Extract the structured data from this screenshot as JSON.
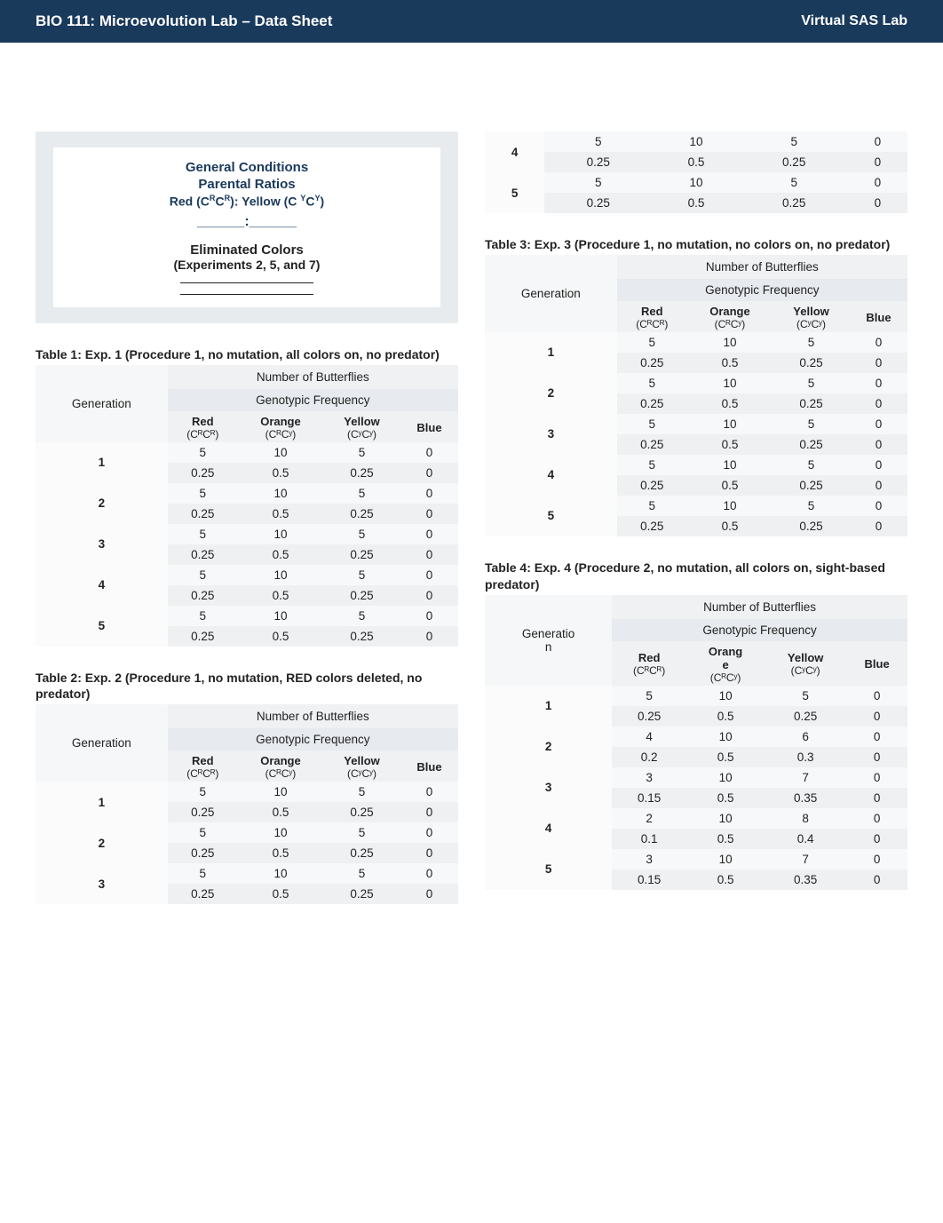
{
  "header": {
    "left": "BIO 111: Microevolution Lab – Data Sheet",
    "right": "Virtual SAS Lab"
  },
  "conditions": {
    "title": "General Conditions",
    "subtitle": "Parental Ratios",
    "formula_prefix": "Red (C",
    "formula_mid": "): Yellow (C ",
    "formula_suffix": ")",
    "sup_r": "R",
    "sup_y": "Y",
    "blank": "______:______",
    "elim_title": "Eliminated Colors",
    "elim_sub": "(Experiments 2, 5, and 7)"
  },
  "colheads": {
    "generation": "Generation",
    "generation_short": "Generatio\nn",
    "num_butterflies": "Number of Butterflies",
    "geno_freq": "Genotypic Frequency",
    "red": "Red",
    "red_sub": "(CᴿCᴿ)",
    "orange": "Orange",
    "orange_split": "Orang\ne",
    "orange_sub": "(CᴿCʸ)",
    "yellow": "Yellow",
    "yellow_sub": "(CʸCʸ)",
    "blue": "Blue"
  },
  "tables": [
    {
      "title": "Table 1: Exp. 1 (Procedure 1, no mutation, all colors on, no predator)",
      "rows": [
        {
          "gen": "1",
          "count": [
            5,
            10,
            5,
            0
          ],
          "freq": [
            0.25,
            0.5,
            0.25,
            0
          ]
        },
        {
          "gen": "2",
          "count": [
            5,
            10,
            5,
            0
          ],
          "freq": [
            0.25,
            0.5,
            0.25,
            0
          ]
        },
        {
          "gen": "3",
          "count": [
            5,
            10,
            5,
            0
          ],
          "freq": [
            0.25,
            0.5,
            0.25,
            0
          ]
        },
        {
          "gen": "4",
          "count": [
            5,
            10,
            5,
            0
          ],
          "freq": [
            0.25,
            0.5,
            0.25,
            0
          ]
        },
        {
          "gen": "5",
          "count": [
            5,
            10,
            5,
            0
          ],
          "freq": [
            0.25,
            0.5,
            0.25,
            0
          ]
        }
      ]
    },
    {
      "title": "Table 2: Exp. 2 (Procedure 1, no mutation, RED colors deleted, no predator)",
      "rows": [
        {
          "gen": "1",
          "count": [
            5,
            10,
            5,
            0
          ],
          "freq": [
            0.25,
            0.5,
            0.25,
            0
          ]
        },
        {
          "gen": "2",
          "count": [
            5,
            10,
            5,
            0
          ],
          "freq": [
            0.25,
            0.5,
            0.25,
            0
          ]
        },
        {
          "gen": "3",
          "count": [
            5,
            10,
            5,
            0
          ],
          "freq": [
            0.25,
            0.5,
            0.25,
            0
          ]
        },
        {
          "gen": "4",
          "count": [
            5,
            10,
            5,
            0
          ],
          "freq": [
            0.25,
            0.5,
            0.25,
            0
          ]
        },
        {
          "gen": "5",
          "count": [
            5,
            10,
            5,
            0
          ],
          "freq": [
            0.25,
            0.5,
            0.25,
            0
          ]
        }
      ]
    },
    {
      "title": "Table 3: Exp. 3 (Procedure 1, no mutation, no colors on, no predator)",
      "rows": [
        {
          "gen": "1",
          "count": [
            5,
            10,
            5,
            0
          ],
          "freq": [
            0.25,
            0.5,
            0.25,
            0
          ]
        },
        {
          "gen": "2",
          "count": [
            5,
            10,
            5,
            0
          ],
          "freq": [
            0.25,
            0.5,
            0.25,
            0
          ]
        },
        {
          "gen": "3",
          "count": [
            5,
            10,
            5,
            0
          ],
          "freq": [
            0.25,
            0.5,
            0.25,
            0
          ]
        },
        {
          "gen": "4",
          "count": [
            5,
            10,
            5,
            0
          ],
          "freq": [
            0.25,
            0.5,
            0.25,
            0
          ]
        },
        {
          "gen": "5",
          "count": [
            5,
            10,
            5,
            0
          ],
          "freq": [
            0.25,
            0.5,
            0.25,
            0
          ]
        }
      ]
    },
    {
      "title": "Table 4: Exp. 4 (Procedure 2, no mutation, all colors on, sight-based predator)",
      "rows": [
        {
          "gen": "1",
          "count": [
            5,
            10,
            5,
            0
          ],
          "freq": [
            0.25,
            0.5,
            0.25,
            0
          ]
        },
        {
          "gen": "2",
          "count": [
            4,
            10,
            6,
            0
          ],
          "freq": [
            0.2,
            0.5,
            0.3,
            0
          ]
        },
        {
          "gen": "3",
          "count": [
            3,
            10,
            7,
            0
          ],
          "freq": [
            0.15,
            0.5,
            0.35,
            0
          ]
        },
        {
          "gen": "4",
          "count": [
            2,
            10,
            8,
            0
          ],
          "freq": [
            0.1,
            0.5,
            0.4,
            0
          ]
        },
        {
          "gen": "5",
          "count": [
            3,
            10,
            7,
            0
          ],
          "freq": [
            0.15,
            0.5,
            0.35,
            0
          ]
        }
      ]
    }
  ]
}
